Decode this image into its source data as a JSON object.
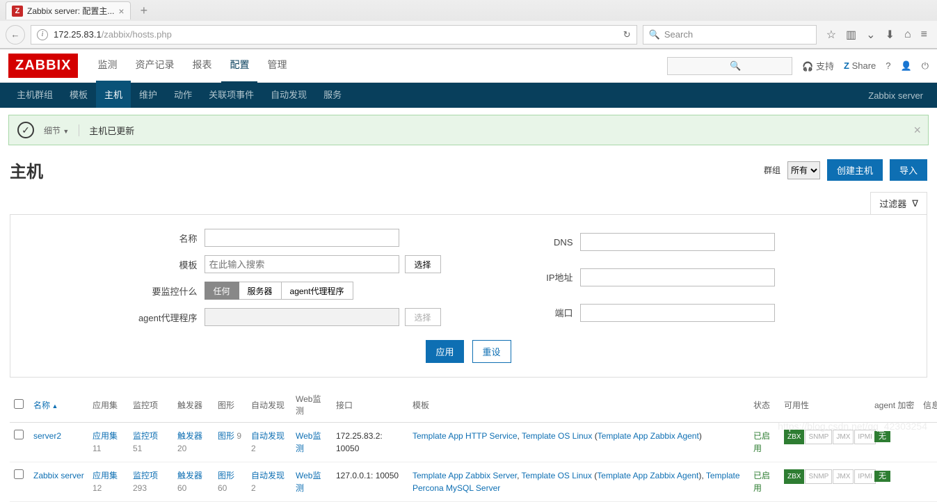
{
  "browser": {
    "tab_title": "Zabbix server: 配置主...",
    "url_host": "172.25.83.1",
    "url_path": "/zabbix/hosts.php",
    "search_placeholder": "Search"
  },
  "header": {
    "logo": "ZABBIX",
    "menu": [
      "监测",
      "资产记录",
      "报表",
      "配置",
      "管理"
    ],
    "active_menu": 3,
    "support": "支持",
    "share": "Share",
    "server_name": "Zabbix server"
  },
  "subnav": {
    "items": [
      "主机群组",
      "模板",
      "主机",
      "维护",
      "动作",
      "关联项事件",
      "自动发现",
      "服务"
    ],
    "active": 2
  },
  "banner": {
    "detail": "细节",
    "msg": "主机已更新"
  },
  "title": {
    "text": "主机",
    "group_label": "群组",
    "group_value": "所有",
    "create": "创建主机",
    "import": "导入"
  },
  "filter": {
    "toggle": "过滤器",
    "name_label": "名称",
    "template_label": "模板",
    "template_placeholder": "在此输入搜索",
    "select_btn": "选择",
    "monitor_label": "要监控什么",
    "monitor_options": [
      "任何",
      "服务器",
      "agent代理程序"
    ],
    "agent_label": "agent代理程序",
    "dns_label": "DNS",
    "ip_label": "IP地址",
    "port_label": "端口",
    "apply": "应用",
    "reset": "重设"
  },
  "columns": {
    "name": "名称",
    "apps": "应用集",
    "items": "监控项",
    "triggers": "触发器",
    "graphs": "图形",
    "discovery": "自动发现",
    "web": "Web监测",
    "interface": "接口",
    "templates_h": "模板",
    "status": "状态",
    "availability": "可用性",
    "agent_enc": "agent 加密",
    "info": "信息"
  },
  "linklabels": {
    "apps": "应用集",
    "items": "监控项",
    "triggers": "触发器",
    "graphs": "图形",
    "discovery": "自动发现",
    "web": "Web监测",
    "enabled": "已启用",
    "enc_none": "无"
  },
  "avail": [
    "ZBX",
    "SNMP",
    "JMX",
    "IPMI"
  ],
  "rows": [
    {
      "name": "server2",
      "apps": 11,
      "items": 51,
      "triggers": 20,
      "graphs": 9,
      "discovery": 2,
      "web": "",
      "interface": "172.25.83.2: 10050",
      "templates": [
        {
          "t": "Template App HTTP Service"
        },
        {
          "t": "Template OS Linux",
          "paren": "Template App Zabbix Agent"
        }
      ]
    },
    {
      "name": "Zabbix server",
      "apps": 12,
      "items": 293,
      "triggers": 60,
      "graphs": 60,
      "discovery": 2,
      "web": "",
      "interface": "127.0.0.1: 10050",
      "templates": [
        {
          "t": "Template App Zabbix Server"
        },
        {
          "t": "Template OS Linux",
          "paren": "Template App Zabbix Agent"
        },
        {
          "t": "Template Percona MySQL Server"
        }
      ]
    }
  ],
  "watermark": "https://blog.csdn.net/qq_42303254"
}
